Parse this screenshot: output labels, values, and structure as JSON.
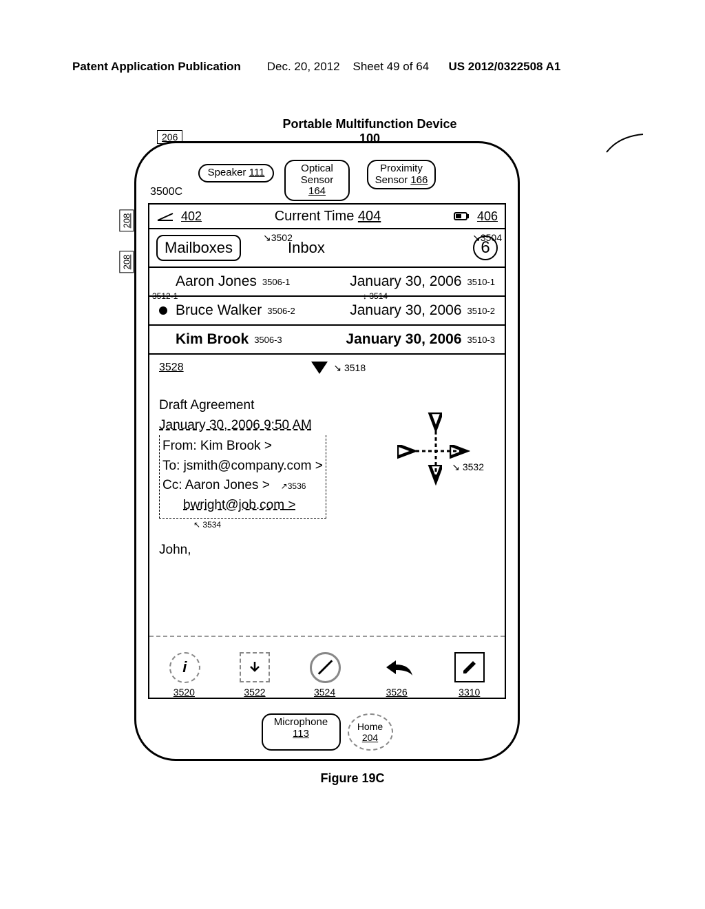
{
  "header": {
    "left": "Patent Application Publication",
    "date": "Dec. 20, 2012",
    "sheet": "Sheet 49 of 64",
    "pubnum": "US 2012/0322508 A1"
  },
  "device": {
    "title": "Portable Multifunction Device",
    "num": "100",
    "figure_ref": "3500C",
    "speaker_label": "Speaker",
    "speaker_ref": "111",
    "optical_label": "Optical Sensor",
    "optical_ref": "164",
    "proximity_label": "Proximity Sensor",
    "proximity_ref": "166",
    "microphone_label": "Microphone",
    "microphone_ref": "113",
    "home_label": "Home",
    "home_ref": "204"
  },
  "refs": {
    "r206": "206",
    "r208a": "208",
    "r208b": "208",
    "r402": "402",
    "r404": "404",
    "r406": "406",
    "r3502": "3502",
    "r3504": "3504",
    "r3506_1": "3506-1",
    "r3510_1": "3510-1",
    "r3506_2": "3506-2",
    "r3510_2": "3510-2",
    "r3512_1": "3512-1",
    "r3514": "3514",
    "r3506_3": "3506-3",
    "r3510_3": "3510-3",
    "r3528": "3528",
    "r3518": "3518",
    "r3532": "3532",
    "r3534": "3534",
    "r3536": "3536",
    "r3520": "3520",
    "r3522": "3522",
    "r3524": "3524",
    "r3526": "3526",
    "r3310": "3310"
  },
  "statusbar": {
    "time_label": "Current Time"
  },
  "mail": {
    "mailboxes_label": "Mailboxes",
    "inbox_label": "Inbox",
    "unread_count": "6"
  },
  "messages": [
    {
      "sender": "Aaron Jones",
      "date": "January 30, 2006"
    },
    {
      "sender": "Bruce Walker",
      "date": "January 30, 2006"
    },
    {
      "sender": "Kim Brook",
      "date": "January 30, 2006"
    }
  ],
  "detail": {
    "subject": "Draft Agreement",
    "timestamp": "January 30, 2006 9:50 AM",
    "from_label": "From:",
    "from_name": "Kim Brook",
    "to_label": "To:",
    "to_addr": "jsmith@company.com",
    "cc_label": "Cc:",
    "cc_name": "Aaron Jones",
    "cc_addr2": "bwright@job.com",
    "body_greeting": "John,",
    "chevron": ">"
  },
  "caption": "Figure 19C"
}
